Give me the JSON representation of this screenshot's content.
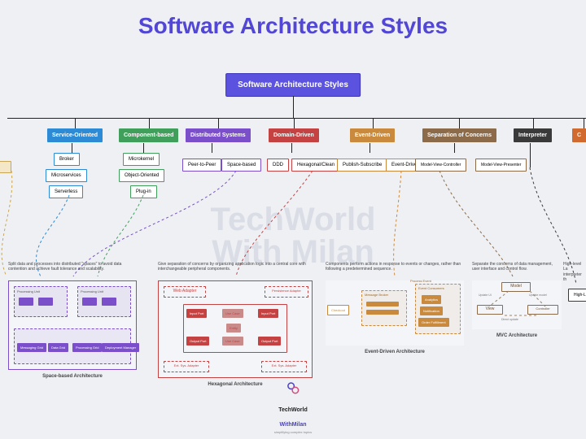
{
  "title": "Software Architecture Styles",
  "root": "Software Architecture Styles",
  "categories": [
    {
      "label": "Service-Oriented",
      "color": "#2d8bd6",
      "children": [
        "Broker",
        "Microservices",
        "Serverless"
      ]
    },
    {
      "label": "Component-based",
      "color": "#40a05b",
      "children": [
        "Microkernel",
        "Object-Oriented",
        "Plug-in"
      ]
    },
    {
      "label": "Distributed Systems",
      "color": "#7a4fc9",
      "children": [
        "Peer-to-Peer",
        "Space-based"
      ]
    },
    {
      "label": "Domain-Driven",
      "color": "#c54242",
      "children": [
        "DDD",
        "Hexagonal/Clean"
      ]
    },
    {
      "label": "Event-Driven",
      "color": "#c98a3d",
      "children": [
        "Publish-Subscribe",
        "Event-Driven"
      ]
    },
    {
      "label": "Separation of Concerns",
      "color": "#8b6b4a",
      "children": [
        "Model-View-Controller",
        "Model-View-Presenter"
      ]
    },
    {
      "label": "Interpreter",
      "color": "#3a3a3a",
      "children": []
    },
    {
      "label": "C",
      "color": "#d06a2f",
      "children": []
    }
  ],
  "descriptions": {
    "space_based": "Split data and processes into distributed \"spaces\" to avoid data contention and achieve fault tolerance and scalability.",
    "hexagonal": "Give separation of concerns by organizing application logic into a central core with interchangeable peripheral components.",
    "event_driven": "Components perform actions in response to events or changes, rather than following a predetermined sequence.",
    "mvc": "Separate the concerns of data management, user interface and control flow.",
    "interpreter": "High-level La interpreter th"
  },
  "panels": {
    "space_based": {
      "title": "Space-based Architecture",
      "parts": [
        "Processing Unit",
        "Messaging Grid",
        "Data Grid",
        "Processing Grid",
        "Deployment Manager"
      ]
    },
    "hexagonal": {
      "title": "Hexagonal Architecture",
      "inner": [
        "Web Adapter",
        "Persistence Adapter",
        "Input Port",
        "Use Case",
        "Input Port",
        "Entity",
        "Output Port",
        "Use Case",
        "Output Port",
        "Ext. Sys. Adapter",
        "Ext. Sys. Adapter"
      ]
    },
    "event_driven": {
      "title": "Event-Driven Architecture",
      "parts": [
        "Checkout",
        "Message Broker",
        "Event Consumers",
        "Analytics",
        "Notification",
        "Order Fulfillment",
        "Process Event"
      ]
    },
    "mvc": {
      "title": "MVC Architecture",
      "parts": [
        "Model",
        "View",
        "Controller",
        "Update UI",
        "Update model",
        "Direct update"
      ]
    },
    "interpreter_leaf": "High-Leve"
  },
  "watermark": "TechWorld\nWith Milan",
  "logo": {
    "line1": "TechWorld",
    "line2": "WithMilan",
    "tagline": "simplifying complex topics"
  }
}
